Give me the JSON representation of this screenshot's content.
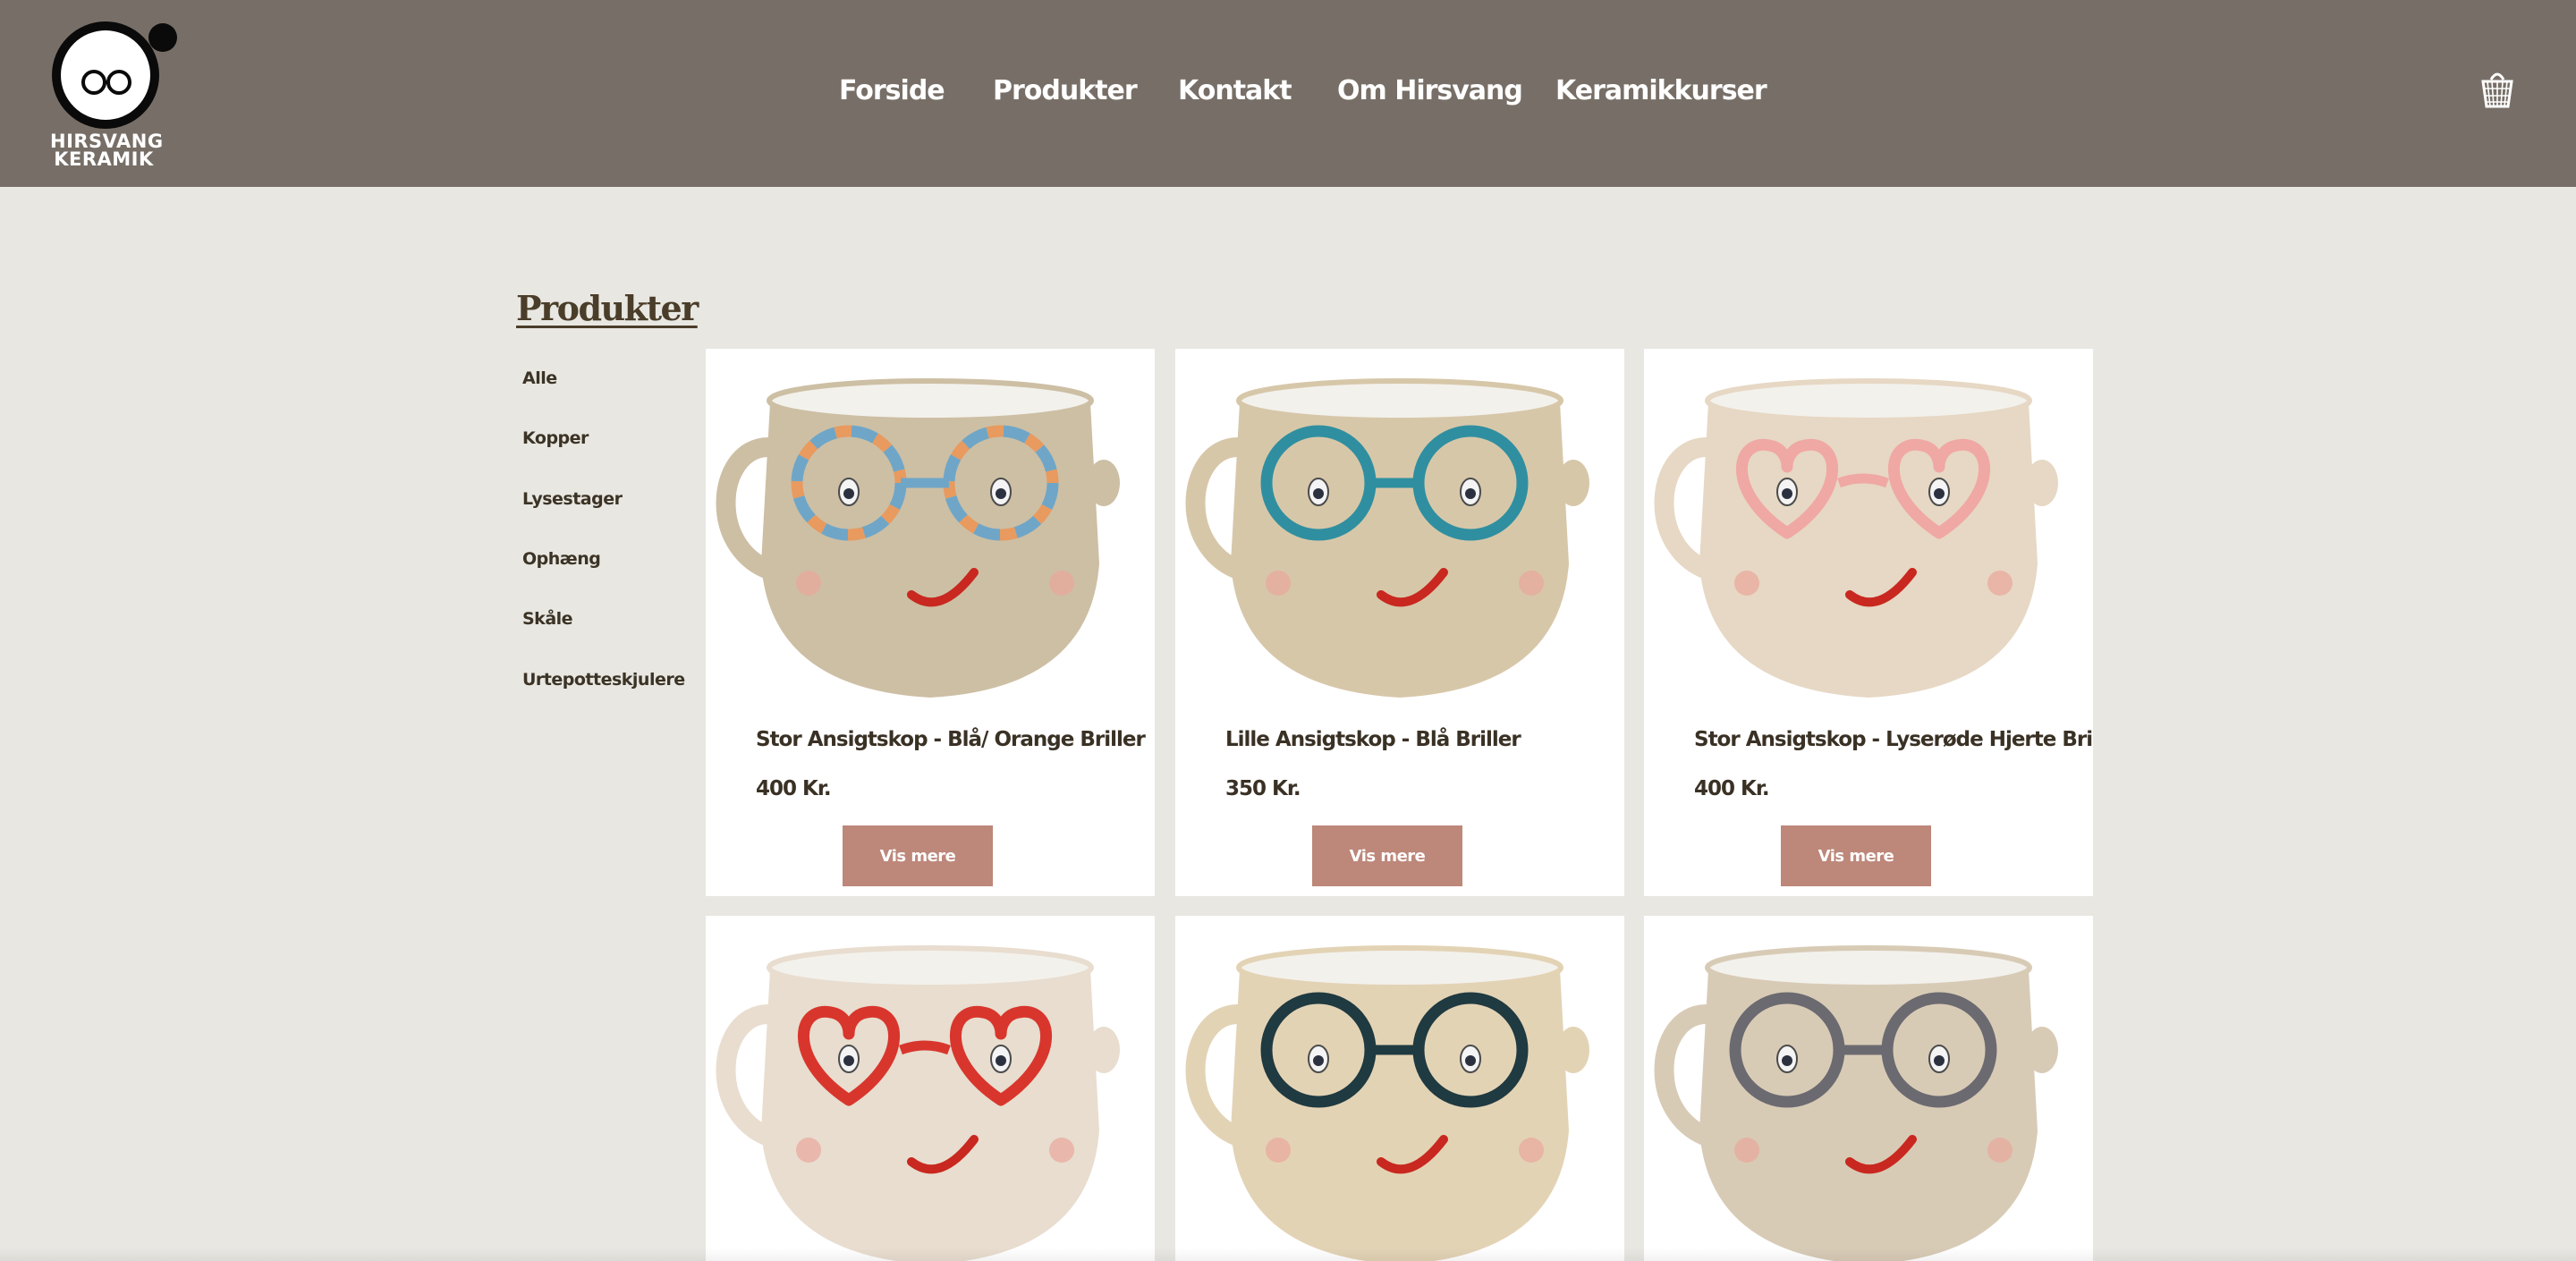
{
  "brand": {
    "logo_line1": "HIRSVANG",
    "logo_line2": "KERAMIK"
  },
  "nav": {
    "items": [
      "Forside",
      "Produkter",
      "Kontakt",
      "Om Hirsvang",
      "Keramikkurser"
    ],
    "cart_icon": "basket-icon"
  },
  "page": {
    "title": "Produkter"
  },
  "sidebar": {
    "categories": [
      "Alle",
      "Kopper",
      "Lysestager",
      "Ophæng",
      "Skåle",
      "Urtepotteskjulere"
    ]
  },
  "products": [
    {
      "title": "Stor Ansigtskop - Blå/ Orange Briller",
      "price": "400 Kr.",
      "button": "Vis mere",
      "glasses_color": "#6fa6c8",
      "glasses_color2": "#e89a5f",
      "glasses_shape": "round"
    },
    {
      "title": "Lille Ansigtskop - Blå Briller",
      "price": "350 Kr.",
      "button": "Vis mere",
      "glasses_color": "#2f8fa0",
      "glasses_color2": "#2f8fa0",
      "glasses_shape": "round"
    },
    {
      "title": "Stor Ansigtskop - Lyserøde Hjerte Briller",
      "price": "400 Kr.",
      "button": "Vis mere",
      "glasses_color": "#f0a8a4",
      "glasses_color2": "#f0a8a4",
      "glasses_shape": "heart"
    },
    {
      "title": "",
      "price": "",
      "button": "",
      "glasses_color": "#d8362d",
      "glasses_color2": "#d8362d",
      "glasses_shape": "heart"
    },
    {
      "title": "",
      "price": "",
      "button": "",
      "glasses_color": "#1f3a40",
      "glasses_color2": "#1f3a40",
      "glasses_shape": "round"
    },
    {
      "title": "",
      "price": "",
      "button": "",
      "glasses_color": "#6b6a70",
      "glasses_color2": "#6b6a70",
      "glasses_shape": "round"
    }
  ],
  "colors": {
    "header_bg": "#776f67",
    "page_bg": "#e8e7e2",
    "button_bg": "#bd877a",
    "text_dark": "#3a3125"
  }
}
